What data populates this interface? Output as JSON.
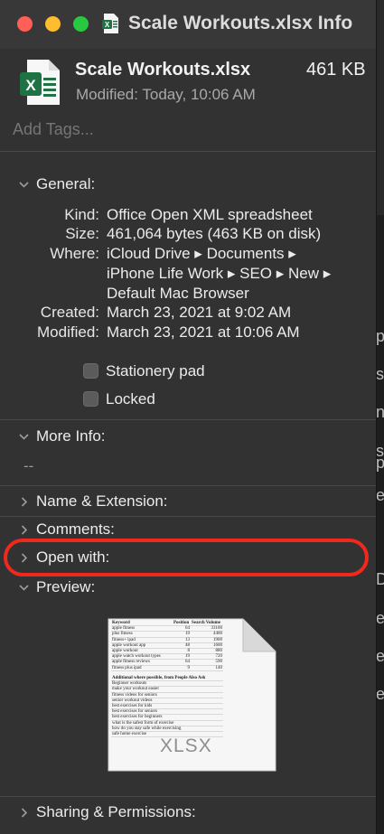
{
  "window": {
    "title": "Scale Workouts.xlsx Info"
  },
  "file": {
    "name": "Scale Workouts.xlsx",
    "size_short": "461 KB",
    "modified_line": "Modified: Today, 10:06 AM",
    "icon_letter": "X"
  },
  "tags": {
    "placeholder": "Add Tags..."
  },
  "general": {
    "label": "General:",
    "kind_key": "Kind:",
    "kind": "Office Open XML spreadsheet",
    "size_key": "Size:",
    "size": "461,064 bytes (463 KB on disk)",
    "where_key": "Where:",
    "where_1": "iCloud Drive ▸ Documents ▸",
    "where_2": "iPhone Life Work ▸ SEO ▸ New ▸",
    "where_3": "Default Mac Browser",
    "created_key": "Created:",
    "created": "March 23, 2021 at 9:02 AM",
    "modified_key": "Modified:",
    "modified": "March 23, 2021 at 10:06 AM",
    "stationery_label": "Stationery pad",
    "locked_label": "Locked"
  },
  "more_info": {
    "label": "More Info:",
    "value": "--"
  },
  "sections": {
    "name_extension": "Name & Extension:",
    "comments": "Comments:",
    "open_with": "Open with:",
    "preview": "Preview:",
    "sharing": "Sharing & Permissions:"
  },
  "preview": {
    "type_label": "XLSX",
    "header": [
      "Keyword",
      "Position",
      "Search Volume"
    ],
    "rows": [
      [
        "apple fitness",
        "64",
        "33100"
      ],
      [
        "plus fitness",
        "19",
        "4400"
      ],
      [
        "fitness+ ipad",
        "13",
        "1900"
      ],
      [
        "apple workout app",
        "48",
        "1600"
      ],
      [
        "apple workout",
        "8",
        "880"
      ],
      [
        "apple watch workout types",
        "19",
        "720"
      ],
      [
        "apple fitness reviews",
        "64",
        "590"
      ],
      [
        "fitness plus ipad",
        "9",
        "140"
      ]
    ],
    "subhead": "Additional where possible, from People Also Ask",
    "list": [
      "Beginner workouts",
      "make your workout easier",
      "fitness videos for seniors",
      "senior workout videos",
      "best exercises for kids",
      "best exercises for seniors",
      "best exercises for beginners",
      "what is the safest form of exercise",
      "how do you stay safe while exercising",
      "safe home exercise"
    ]
  },
  "colors": {
    "accent_red": "#f1281c",
    "excel_green": "#1f7244",
    "traffic_red": "#fe5f57",
    "traffic_yellow": "#febc2e",
    "traffic_green": "#28c840"
  },
  "background_window": {
    "letters": [
      "p",
      "s",
      "n",
      "s",
      "p",
      "e",
      "D",
      "e",
      "e",
      "e"
    ]
  }
}
